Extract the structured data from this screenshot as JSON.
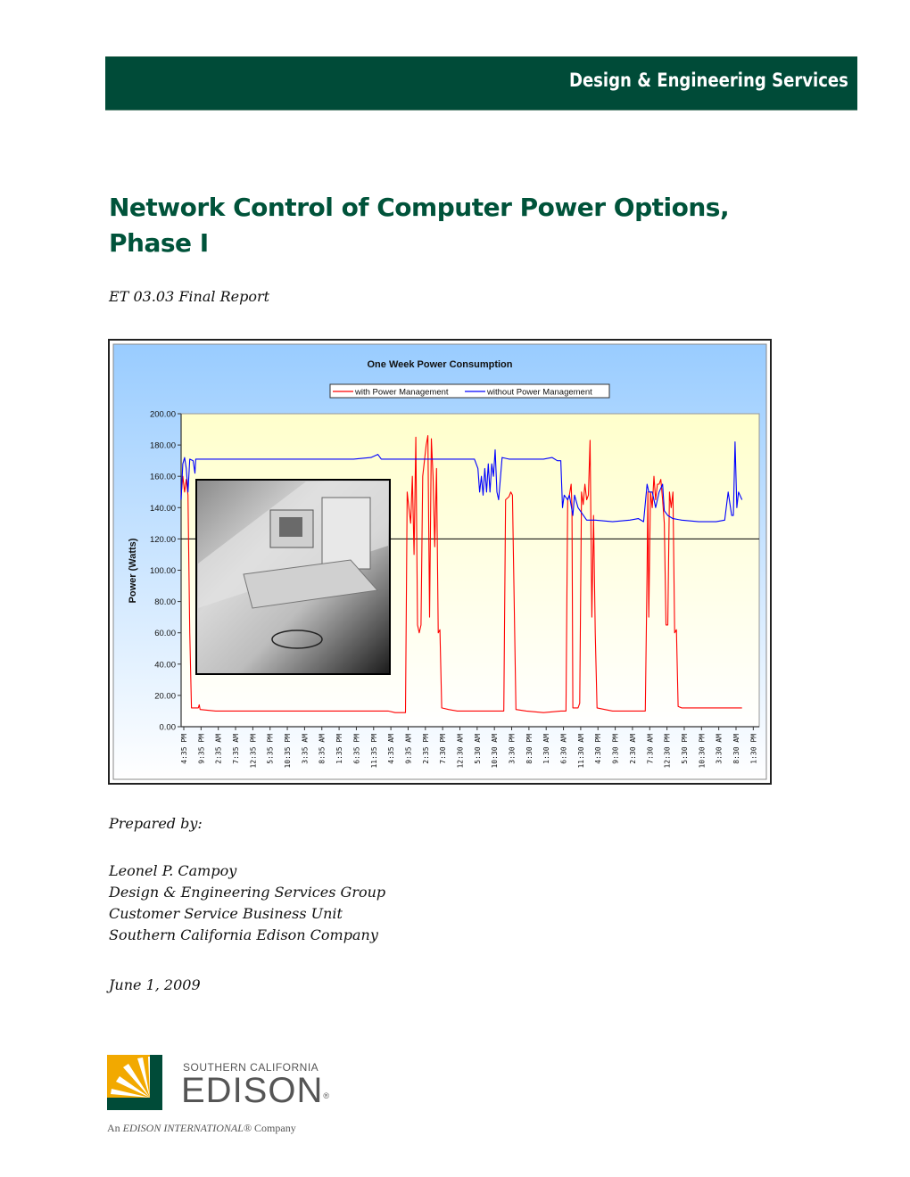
{
  "banner": {
    "text": "Design & Engineering Services"
  },
  "report": {
    "title_line1": "Network Control of Computer Power Options,",
    "title_line2": "Phase I",
    "subtitle": "ET 03.03 Final Report"
  },
  "prepared": {
    "label": "Prepared by:",
    "author": "Leonel P. Campoy",
    "group": "Design & Engineering Services Group",
    "unit": "Customer Service Business Unit",
    "company": "Southern California Edison Company",
    "date": "June 1, 2009"
  },
  "logo": {
    "line1": "SOUTHERN CALIFORNIA",
    "line2": "EDISON",
    "registered": "®",
    "tagline_prefix": "An ",
    "tagline_brand": "EDISON INTERNATIONAL®",
    "tagline_suffix": " Company",
    "colors": {
      "sun": "#f2a900",
      "green": "#004b38"
    }
  },
  "colors": {
    "brand_green": "#004b38",
    "title_green": "#00533a"
  },
  "chart_data": {
    "type": "line",
    "title": "One Week Power Consumption",
    "xlabel": "",
    "ylabel": "Power (Watts)",
    "ylim": [
      0,
      200
    ],
    "yticks": [
      "0.00",
      "20.00",
      "40.00",
      "60.00",
      "80.00",
      "100.00",
      "120.00",
      "140.00",
      "160.00",
      "180.00",
      "200.00"
    ],
    "reference_line": 120,
    "grid": false,
    "legend": "top-center",
    "categories": [
      "4:35 PM",
      "9:35 PM",
      "2:35 AM",
      "7:35 AM",
      "12:35 PM",
      "5:35 PM",
      "10:35 PM",
      "3:35 AM",
      "8:35 AM",
      "1:35 PM",
      "6:35 PM",
      "11:35 PM",
      "4:35 AM",
      "9:35 AM",
      "2:35 PM",
      "7:30 PM",
      "12:30 AM",
      "5:30 AM",
      "10:30 AM",
      "3:30 PM",
      "8:30 PM",
      "1:30 AM",
      "6:30 AM",
      "11:30 AM",
      "4:30 PM",
      "9:30 PM",
      "2:30 AM",
      "7:30 AM",
      "12:30 PM",
      "5:30 PM",
      "10:30 PM",
      "3:30 AM",
      "8:30 AM",
      "1:30 PM"
    ],
    "series": [
      {
        "name": "with Power Management",
        "color": "#ff0000",
        "points": [
          [
            0,
            148
          ],
          [
            0.1,
            160
          ],
          [
            0.2,
            150
          ],
          [
            0.3,
            158
          ],
          [
            0.4,
            148
          ],
          [
            0.5,
            60
          ],
          [
            0.6,
            12
          ],
          [
            1.0,
            12
          ],
          [
            1.05,
            14
          ],
          [
            1.1,
            11
          ],
          [
            2,
            10
          ],
          [
            4,
            10
          ],
          [
            6,
            10
          ],
          [
            8,
            10
          ],
          [
            10,
            10
          ],
          [
            12,
            10
          ],
          [
            12.4,
            9
          ],
          [
            13.0,
            9
          ],
          [
            13.1,
            150
          ],
          [
            13.2,
            140
          ],
          [
            13.3,
            130
          ],
          [
            13.4,
            160
          ],
          [
            13.5,
            110
          ],
          [
            13.6,
            185
          ],
          [
            13.7,
            65
          ],
          [
            13.8,
            60
          ],
          [
            13.9,
            65
          ],
          [
            14.0,
            160
          ],
          [
            14.2,
            180
          ],
          [
            14.3,
            186
          ],
          [
            14.4,
            70
          ],
          [
            14.5,
            184
          ],
          [
            14.6,
            160
          ],
          [
            14.7,
            115
          ],
          [
            14.8,
            165
          ],
          [
            14.9,
            60
          ],
          [
            15.0,
            62
          ],
          [
            15.1,
            12
          ],
          [
            15.5,
            11
          ],
          [
            16,
            10
          ],
          [
            17,
            10
          ],
          [
            18,
            10
          ],
          [
            18.7,
            10
          ],
          [
            18.8,
            145
          ],
          [
            19.0,
            147
          ],
          [
            19.1,
            150
          ],
          [
            19.2,
            148
          ],
          [
            19.4,
            11
          ],
          [
            20,
            10
          ],
          [
            21,
            9
          ],
          [
            22,
            10
          ],
          [
            22.3,
            10
          ],
          [
            22.4,
            145
          ],
          [
            22.5,
            148
          ],
          [
            22.6,
            155
          ],
          [
            22.65,
            140
          ],
          [
            22.7,
            12
          ],
          [
            23.0,
            12
          ],
          [
            23.1,
            15
          ],
          [
            23.2,
            150
          ],
          [
            23.3,
            142
          ],
          [
            23.4,
            155
          ],
          [
            23.5,
            145
          ],
          [
            23.6,
            148
          ],
          [
            23.7,
            183
          ],
          [
            23.8,
            70
          ],
          [
            23.9,
            135
          ],
          [
            24.0,
            60
          ],
          [
            24.1,
            12
          ],
          [
            25,
            10
          ],
          [
            26,
            10
          ],
          [
            26.9,
            10
          ],
          [
            27.0,
            100
          ],
          [
            27.05,
            150
          ],
          [
            27.1,
            70
          ],
          [
            27.2,
            150
          ],
          [
            27.3,
            140
          ],
          [
            27.4,
            160
          ],
          [
            27.5,
            145
          ],
          [
            27.6,
            155
          ],
          [
            27.7,
            155
          ],
          [
            27.8,
            158
          ],
          [
            27.9,
            145
          ],
          [
            28.0,
            130
          ],
          [
            28.1,
            65
          ],
          [
            28.2,
            65
          ],
          [
            28.3,
            150
          ],
          [
            28.4,
            140
          ],
          [
            28.5,
            150
          ],
          [
            28.6,
            60
          ],
          [
            28.7,
            62
          ],
          [
            28.8,
            13
          ],
          [
            29,
            12
          ],
          [
            30,
            12
          ],
          [
            31,
            12
          ],
          [
            32,
            12
          ],
          [
            32.5,
            12
          ]
        ]
      },
      {
        "name": "without Power Management",
        "color": "#0000ff",
        "points": [
          [
            0,
            145
          ],
          [
            0.1,
            168
          ],
          [
            0.2,
            172
          ],
          [
            0.3,
            165
          ],
          [
            0.4,
            150
          ],
          [
            0.5,
            171
          ],
          [
            0.7,
            170
          ],
          [
            0.8,
            162
          ],
          [
            0.85,
            171
          ],
          [
            1,
            171
          ],
          [
            2,
            171
          ],
          [
            3,
            171
          ],
          [
            4,
            171
          ],
          [
            5,
            171
          ],
          [
            6,
            171
          ],
          [
            7,
            171
          ],
          [
            8,
            171
          ],
          [
            9,
            171
          ],
          [
            10,
            171
          ],
          [
            11,
            172
          ],
          [
            11.4,
            174
          ],
          [
            11.6,
            171
          ],
          [
            12,
            171
          ],
          [
            13,
            171
          ],
          [
            14,
            171
          ],
          [
            15,
            171
          ],
          [
            16,
            171
          ],
          [
            17,
            171
          ],
          [
            17.2,
            165
          ],
          [
            17.3,
            150
          ],
          [
            17.4,
            160
          ],
          [
            17.5,
            148
          ],
          [
            17.6,
            165
          ],
          [
            17.7,
            150
          ],
          [
            17.8,
            168
          ],
          [
            17.9,
            150
          ],
          [
            18.0,
            168
          ],
          [
            18.1,
            160
          ],
          [
            18.2,
            177
          ],
          [
            18.3,
            150
          ],
          [
            18.4,
            145
          ],
          [
            18.6,
            172
          ],
          [
            19,
            171
          ],
          [
            20,
            171
          ],
          [
            21,
            171
          ],
          [
            21.5,
            172
          ],
          [
            21.8,
            170
          ],
          [
            22,
            170
          ],
          [
            22.1,
            140
          ],
          [
            22.2,
            148
          ],
          [
            22.4,
            145
          ],
          [
            22.5,
            148
          ],
          [
            22.7,
            135
          ],
          [
            22.8,
            148
          ],
          [
            23.0,
            140
          ],
          [
            23.5,
            132
          ],
          [
            24,
            132
          ],
          [
            25,
            131
          ],
          [
            26,
            132
          ],
          [
            26.5,
            133
          ],
          [
            26.8,
            131
          ],
          [
            27,
            155
          ],
          [
            27.1,
            150
          ],
          [
            27.3,
            150
          ],
          [
            27.5,
            140
          ],
          [
            27.7,
            150
          ],
          [
            27.9,
            155
          ],
          [
            28.0,
            138
          ],
          [
            28.2,
            135
          ],
          [
            28.5,
            133
          ],
          [
            29,
            132
          ],
          [
            30,
            131
          ],
          [
            31,
            131
          ],
          [
            31.5,
            132
          ],
          [
            31.7,
            150
          ],
          [
            31.9,
            135
          ],
          [
            32.0,
            135
          ],
          [
            32.1,
            182
          ],
          [
            32.2,
            140
          ],
          [
            32.3,
            150
          ],
          [
            32.5,
            145
          ]
        ]
      }
    ],
    "inset_image": "grayscale photo of office computer workstation"
  }
}
